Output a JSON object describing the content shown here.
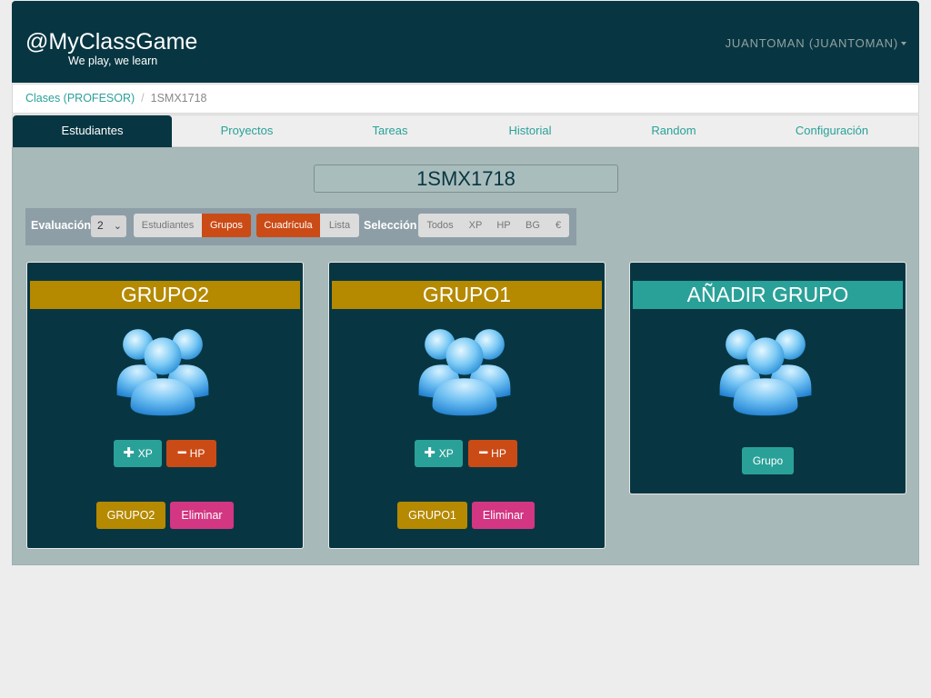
{
  "navbar": {
    "brand": "@MyClassGame",
    "tagline": "We play, we learn",
    "user": "JUANTOMAN (JUANTOMAN)"
  },
  "breadcrumb": {
    "parent": "Clases (PROFESOR)",
    "separator": "/",
    "current": "1SMX1718"
  },
  "tabs": [
    {
      "label": "Estudiantes",
      "active": true
    },
    {
      "label": "Proyectos"
    },
    {
      "label": "Tareas"
    },
    {
      "label": "Historial"
    },
    {
      "label": "Random"
    },
    {
      "label": "Configuración"
    }
  ],
  "class_name": "1SMX1718",
  "toolbar": {
    "evaluacion_label": "Evaluación",
    "evaluacion_value": "2",
    "view_options": [
      "Estudiantes",
      "Grupos"
    ],
    "view_selected": "Grupos",
    "layout_options": [
      "Cuadrícula",
      "Lista"
    ],
    "layout_selected": "Cuadrícula",
    "seleccion_label": "Selección",
    "seleccion_options": [
      "Todos",
      "XP",
      "HP",
      "BG",
      "€"
    ]
  },
  "groups": [
    {
      "title": "GRUPO2",
      "xp_label": "XP",
      "hp_label": "HP",
      "name_button": "GRUPO2",
      "delete_button": "Eliminar"
    },
    {
      "title": "GRUPO1",
      "xp_label": "XP",
      "hp_label": "HP",
      "name_button": "GRUPO1",
      "delete_button": "Eliminar"
    }
  ],
  "add_group": {
    "title": "AÑADIR GRUPO",
    "button": "Grupo"
  },
  "colors": {
    "navbar": "#073642",
    "accent_teal": "#2aa198",
    "orange": "#cb4b16",
    "gold": "#b58900",
    "pink": "#d33682"
  },
  "icons": {
    "group": "group-icon",
    "plus": "plus-icon",
    "minus": "minus-icon",
    "caret": "caret-down-icon"
  }
}
